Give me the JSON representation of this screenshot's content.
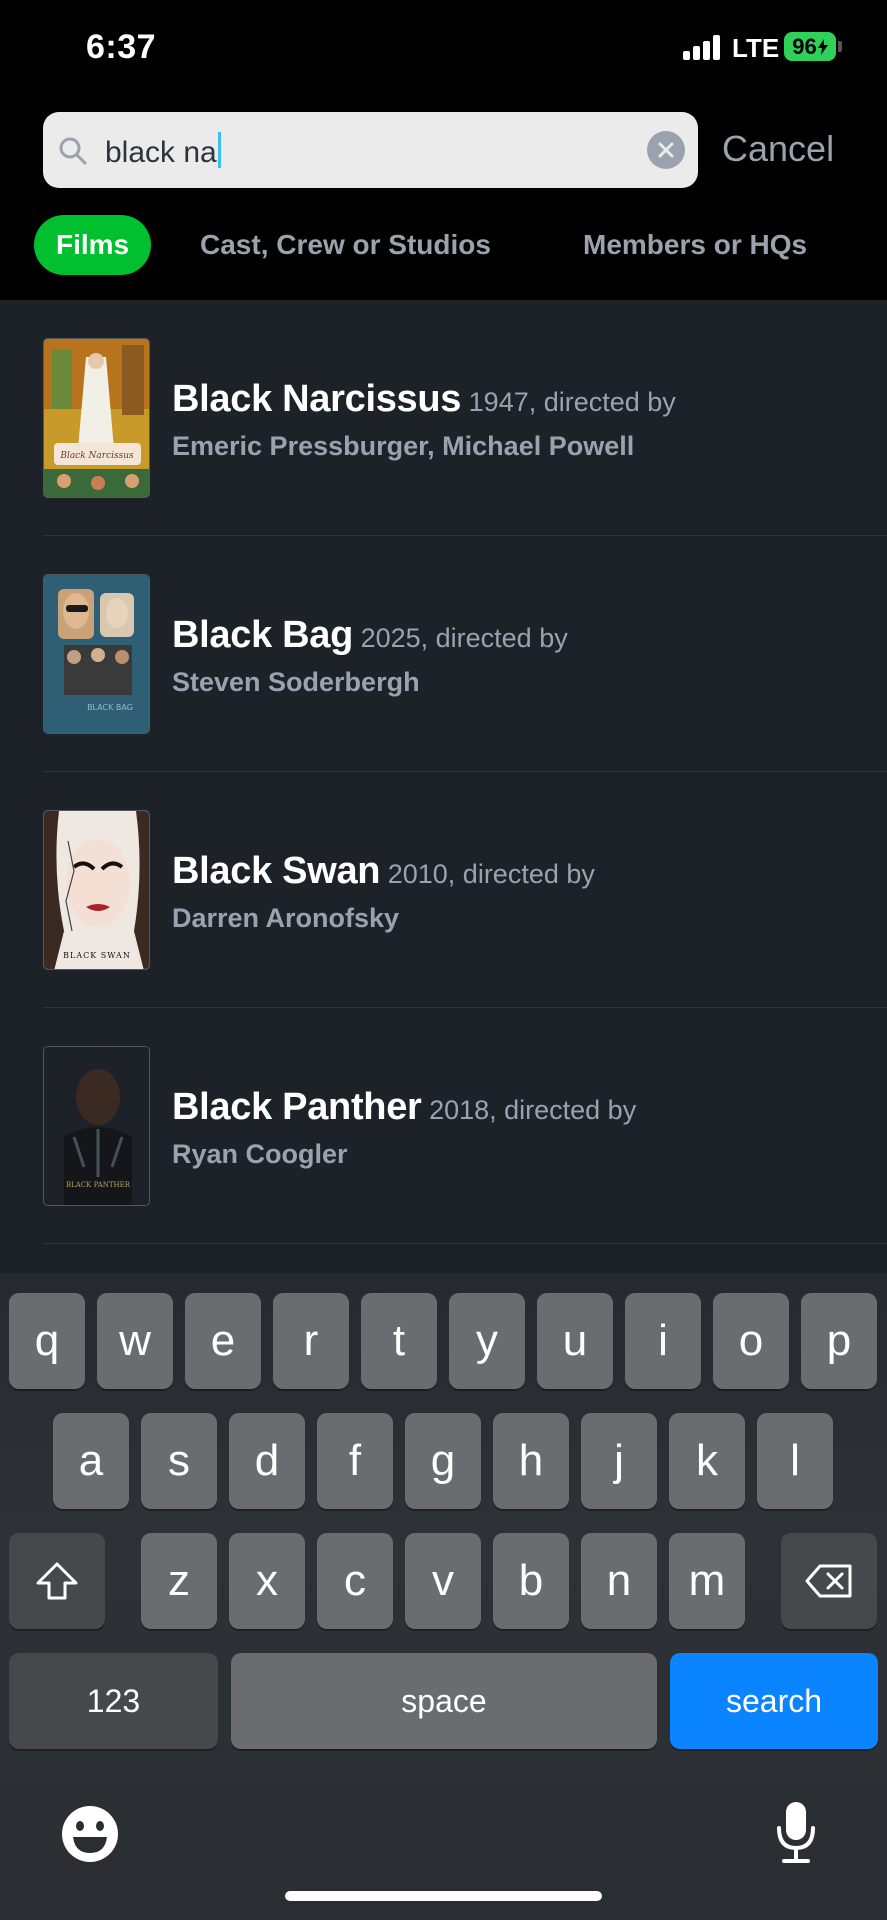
{
  "status_bar": {
    "time": "6:37",
    "network": "LTE",
    "battery": "96"
  },
  "search": {
    "query": "black na",
    "cancel_label": "Cancel"
  },
  "tabs": [
    {
      "label": "Films",
      "active": true
    },
    {
      "label": "Cast, Crew or Studios",
      "active": false
    },
    {
      "label": "Members or HQs",
      "active": false
    }
  ],
  "results": [
    {
      "title": "Black Narcissus",
      "meta": "1947, directed by",
      "directors": [
        "Emeric Pressburger",
        "Michael Powell"
      ],
      "poster_text": "Black Narcissus"
    },
    {
      "title": "Black Bag",
      "meta": "2025, directed by",
      "directors": [
        "Steven Soderbergh"
      ],
      "poster_text": "BLACK BAG"
    },
    {
      "title": "Black Swan",
      "meta": "2010, directed by",
      "directors": [
        "Darren Aronofsky"
      ],
      "poster_text": "BLACK SWAN"
    },
    {
      "title": "Black Panther",
      "meta": "2018, directed by",
      "directors": [
        "Ryan Coogler"
      ],
      "poster_text": "BLACK PANTHER"
    }
  ],
  "keyboard": {
    "row1": [
      "q",
      "w",
      "e",
      "r",
      "t",
      "y",
      "u",
      "i",
      "o",
      "p"
    ],
    "row2": [
      "a",
      "s",
      "d",
      "f",
      "g",
      "h",
      "j",
      "k",
      "l"
    ],
    "row3": [
      "z",
      "x",
      "c",
      "v",
      "b",
      "n",
      "m"
    ],
    "numbers_label": "123",
    "space_label": "space",
    "search_label": "search"
  },
  "colors": {
    "accent_green": "#00c030",
    "keyboard_blue": "#0a84ff",
    "battery_green": "#30d158",
    "muted_text": "#9aa3ad",
    "background": "#1c2228"
  },
  "icons": [
    "search-icon",
    "clear-icon",
    "shift-icon",
    "backspace-icon",
    "emoji-icon",
    "microphone-icon"
  ]
}
